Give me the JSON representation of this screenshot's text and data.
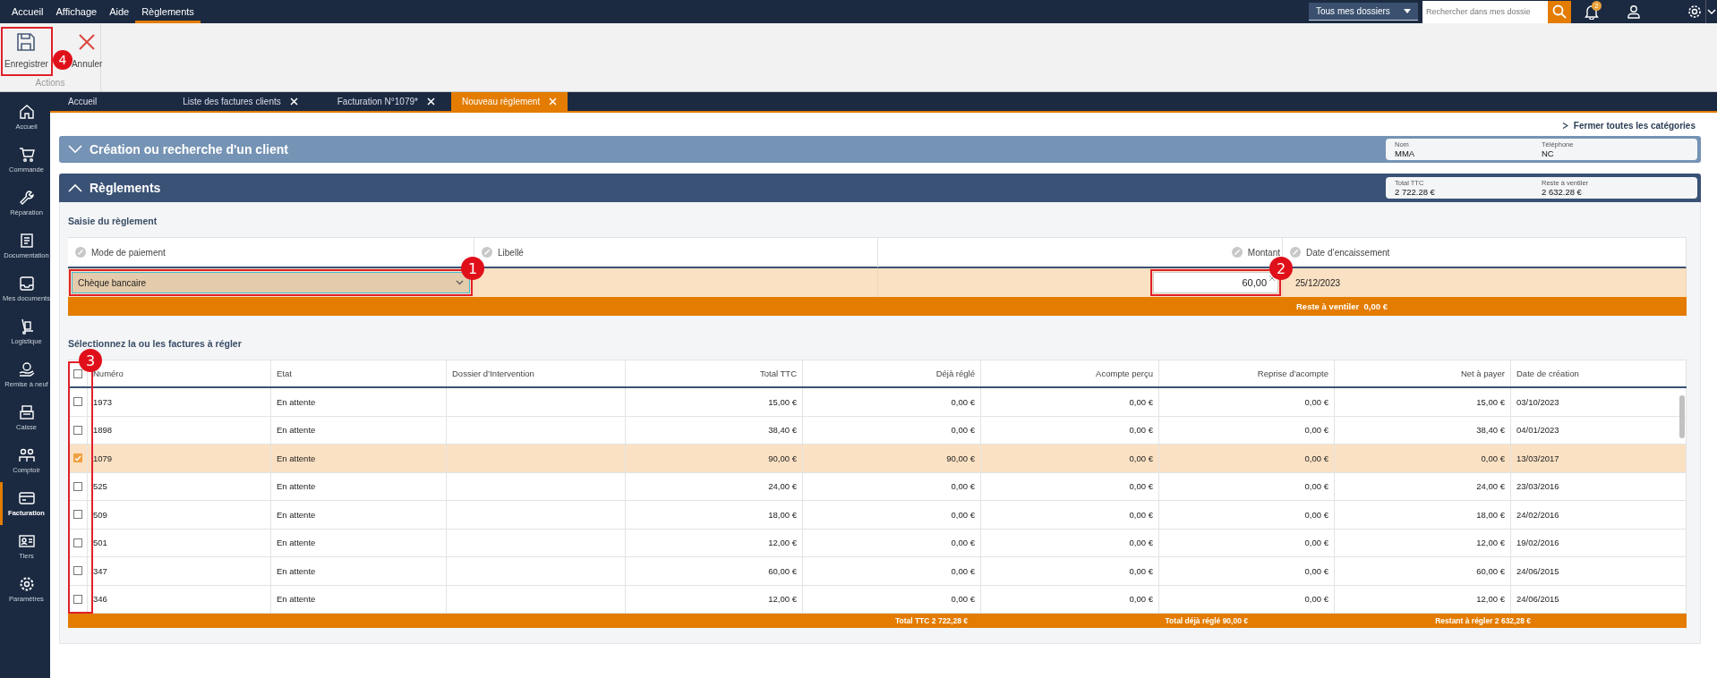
{
  "menu": [
    {
      "label": "Accueil",
      "selected": false
    },
    {
      "label": "Affichage",
      "selected": false
    },
    {
      "label": "Aide",
      "selected": false
    },
    {
      "label": "Règlements",
      "selected": true
    }
  ],
  "top_right": {
    "scope": "Tous mes dossiers",
    "search_placeholder": "Rechercher dans mes dossie",
    "notifications": "2"
  },
  "toolbar": {
    "buttons": [
      {
        "kind": "save",
        "label": "Enregistrer"
      },
      {
        "kind": "cancel",
        "label": "Annuler"
      }
    ],
    "group": "Actions"
  },
  "tabs": [
    {
      "label": "Accueil",
      "closable": false,
      "selected": false
    },
    {
      "label": "Liste des factures clients",
      "closable": true,
      "selected": false
    },
    {
      "label": "Facturation N°1079*",
      "closable": true,
      "selected": false
    },
    {
      "label": "Nouveau règlement",
      "closable": true,
      "selected": true
    }
  ],
  "sidebar": {
    "items": [
      {
        "kind": "home",
        "label": "Accueil",
        "selected": false
      },
      {
        "kind": "cart",
        "label": "Commande",
        "selected": false
      },
      {
        "kind": "wrench",
        "label": "Réparation",
        "selected": false
      },
      {
        "kind": "doc",
        "label": "Documentation",
        "selected": false
      },
      {
        "kind": "inbox",
        "label": "Mes documents",
        "selected": false
      },
      {
        "kind": "trolley",
        "label": "Logistique",
        "selected": false
      },
      {
        "kind": "refurb",
        "label": "Remise à neuf",
        "selected": false
      },
      {
        "kind": "register",
        "label": "Caisse",
        "selected": false
      },
      {
        "kind": "people",
        "label": "Comptoir",
        "selected": false
      },
      {
        "kind": "card",
        "label": "Facturation",
        "selected": true
      },
      {
        "kind": "idcard",
        "label": "Tiers",
        "selected": false
      },
      {
        "kind": "gear",
        "label": "Paramètres",
        "selected": false
      }
    ]
  },
  "close_all": "Fermer toutes les catégories",
  "sections": [
    {
      "title": "Création ou recherche d'un client",
      "expanded": false,
      "fields": [
        {
          "label": "Nom",
          "value": "MMA"
        },
        {
          "label": "Téléphone",
          "value": "NC"
        }
      ]
    },
    {
      "title": "Règlements",
      "expanded": true,
      "fields": [
        {
          "label": "Total TTC",
          "value": "2 722.28 €"
        },
        {
          "label": "Reste à ventiler",
          "value": "2 632.28 €"
        }
      ]
    }
  ],
  "payment": {
    "title": "Saisie du règlement",
    "columns": [
      "Mode de paiement",
      "Libellé",
      "Montant",
      "Date d’encaissement"
    ],
    "mode": "Chèque bancaire",
    "amount": "60,00",
    "date": "25/12/2023",
    "remaining": "Reste à ventiler  0,00 €"
  },
  "invoices": {
    "title": "Sélectionnez la ou les factures à régler",
    "select_all": {
      "checked": false
    },
    "columns": [
      "Numéro",
      "Etat",
      "Dossier d’Intervention",
      "Total TTC",
      "Déjà réglé",
      "Acompte perçu",
      "Reprise d’acompte",
      "Net à payer",
      "Date de création"
    ],
    "rows": [
      {
        "checked": false,
        "selected": false,
        "cells": [
          "1973",
          "En attente",
          "",
          "15,00 €",
          "0,00 €",
          "0,00 €",
          "0,00 €",
          "15,00 €",
          "03/10/2023"
        ]
      },
      {
        "checked": false,
        "selected": false,
        "cells": [
          "1898",
          "En attente",
          "",
          "38,40 €",
          "0,00 €",
          "0,00 €",
          "0,00 €",
          "38,40 €",
          "04/01/2023"
        ]
      },
      {
        "checked": true,
        "selected": true,
        "cells": [
          "1079",
          "En attente",
          "",
          "90,00 €",
          "90,00 €",
          "0,00 €",
          "0,00 €",
          "0,00 €",
          "13/03/2017"
        ]
      },
      {
        "checked": false,
        "selected": false,
        "cells": [
          "525",
          "En attente",
          "",
          "24,00 €",
          "0,00 €",
          "0,00 €",
          "0,00 €",
          "24,00 €",
          "23/03/2016"
        ]
      },
      {
        "checked": false,
        "selected": false,
        "cells": [
          "509",
          "En attente",
          "",
          "18,00 €",
          "0,00 €",
          "0,00 €",
          "0,00 €",
          "18,00 €",
          "24/02/2016"
        ]
      },
      {
        "checked": false,
        "selected": false,
        "cells": [
          "501",
          "En attente",
          "",
          "12,00 €",
          "0,00 €",
          "0,00 €",
          "0,00 €",
          "12,00 €",
          "19/02/2016"
        ]
      },
      {
        "checked": false,
        "selected": false,
        "cells": [
          "347",
          "En attente",
          "",
          "60,00 €",
          "0,00 €",
          "0,00 €",
          "0,00 €",
          "60,00 €",
          "24/06/2015"
        ]
      },
      {
        "checked": false,
        "selected": false,
        "cells": [
          "346",
          "En attente",
          "",
          "12,00 €",
          "0,00 €",
          "0,00 €",
          "0,00 €",
          "12,00 €",
          "24/06/2015"
        ]
      }
    ],
    "totals": [
      "Total TTC 2 722,28 €",
      "Total déjà réglé 90,00 €",
      "Restant à régler 2 632,28 €"
    ]
  },
  "annotations": [
    {
      "label": "1"
    },
    {
      "label": "2"
    },
    {
      "label": "3"
    },
    {
      "label": "4"
    }
  ]
}
